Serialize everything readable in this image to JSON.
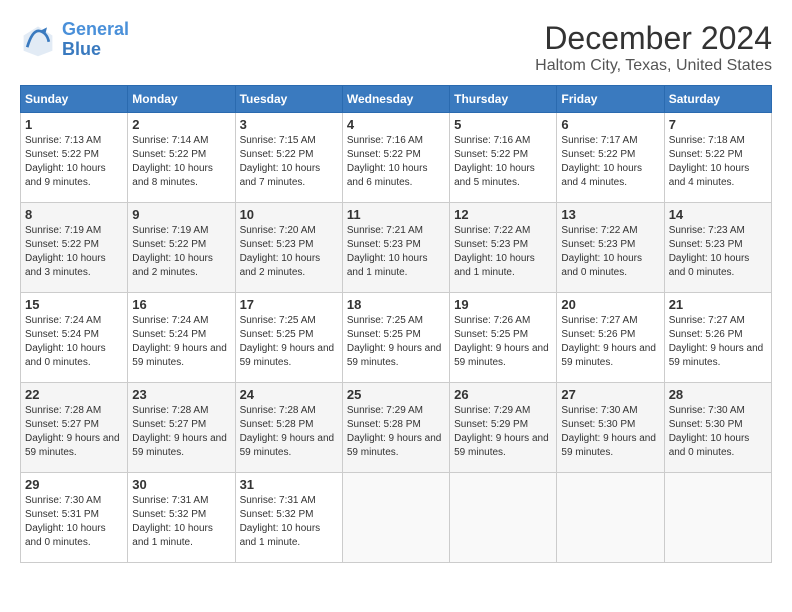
{
  "logo": {
    "line1": "General",
    "line2": "Blue"
  },
  "title": {
    "month_year": "December 2024",
    "location": "Haltom City, Texas, United States"
  },
  "weekdays": [
    "Sunday",
    "Monday",
    "Tuesday",
    "Wednesday",
    "Thursday",
    "Friday",
    "Saturday"
  ],
  "weeks": [
    [
      {
        "day": "1",
        "sunrise": "7:13 AM",
        "sunset": "5:22 PM",
        "daylight": "10 hours and 9 minutes."
      },
      {
        "day": "2",
        "sunrise": "7:14 AM",
        "sunset": "5:22 PM",
        "daylight": "10 hours and 8 minutes."
      },
      {
        "day": "3",
        "sunrise": "7:15 AM",
        "sunset": "5:22 PM",
        "daylight": "10 hours and 7 minutes."
      },
      {
        "day": "4",
        "sunrise": "7:16 AM",
        "sunset": "5:22 PM",
        "daylight": "10 hours and 6 minutes."
      },
      {
        "day": "5",
        "sunrise": "7:16 AM",
        "sunset": "5:22 PM",
        "daylight": "10 hours and 5 minutes."
      },
      {
        "day": "6",
        "sunrise": "7:17 AM",
        "sunset": "5:22 PM",
        "daylight": "10 hours and 4 minutes."
      },
      {
        "day": "7",
        "sunrise": "7:18 AM",
        "sunset": "5:22 PM",
        "daylight": "10 hours and 4 minutes."
      }
    ],
    [
      {
        "day": "8",
        "sunrise": "7:19 AM",
        "sunset": "5:22 PM",
        "daylight": "10 hours and 3 minutes."
      },
      {
        "day": "9",
        "sunrise": "7:19 AM",
        "sunset": "5:22 PM",
        "daylight": "10 hours and 2 minutes."
      },
      {
        "day": "10",
        "sunrise": "7:20 AM",
        "sunset": "5:23 PM",
        "daylight": "10 hours and 2 minutes."
      },
      {
        "day": "11",
        "sunrise": "7:21 AM",
        "sunset": "5:23 PM",
        "daylight": "10 hours and 1 minute."
      },
      {
        "day": "12",
        "sunrise": "7:22 AM",
        "sunset": "5:23 PM",
        "daylight": "10 hours and 1 minute."
      },
      {
        "day": "13",
        "sunrise": "7:22 AM",
        "sunset": "5:23 PM",
        "daylight": "10 hours and 0 minutes."
      },
      {
        "day": "14",
        "sunrise": "7:23 AM",
        "sunset": "5:23 PM",
        "daylight": "10 hours and 0 minutes."
      }
    ],
    [
      {
        "day": "15",
        "sunrise": "7:24 AM",
        "sunset": "5:24 PM",
        "daylight": "10 hours and 0 minutes."
      },
      {
        "day": "16",
        "sunrise": "7:24 AM",
        "sunset": "5:24 PM",
        "daylight": "9 hours and 59 minutes."
      },
      {
        "day": "17",
        "sunrise": "7:25 AM",
        "sunset": "5:25 PM",
        "daylight": "9 hours and 59 minutes."
      },
      {
        "day": "18",
        "sunrise": "7:25 AM",
        "sunset": "5:25 PM",
        "daylight": "9 hours and 59 minutes."
      },
      {
        "day": "19",
        "sunrise": "7:26 AM",
        "sunset": "5:25 PM",
        "daylight": "9 hours and 59 minutes."
      },
      {
        "day": "20",
        "sunrise": "7:27 AM",
        "sunset": "5:26 PM",
        "daylight": "9 hours and 59 minutes."
      },
      {
        "day": "21",
        "sunrise": "7:27 AM",
        "sunset": "5:26 PM",
        "daylight": "9 hours and 59 minutes."
      }
    ],
    [
      {
        "day": "22",
        "sunrise": "7:28 AM",
        "sunset": "5:27 PM",
        "daylight": "9 hours and 59 minutes."
      },
      {
        "day": "23",
        "sunrise": "7:28 AM",
        "sunset": "5:27 PM",
        "daylight": "9 hours and 59 minutes."
      },
      {
        "day": "24",
        "sunrise": "7:28 AM",
        "sunset": "5:28 PM",
        "daylight": "9 hours and 59 minutes."
      },
      {
        "day": "25",
        "sunrise": "7:29 AM",
        "sunset": "5:28 PM",
        "daylight": "9 hours and 59 minutes."
      },
      {
        "day": "26",
        "sunrise": "7:29 AM",
        "sunset": "5:29 PM",
        "daylight": "9 hours and 59 minutes."
      },
      {
        "day": "27",
        "sunrise": "7:30 AM",
        "sunset": "5:30 PM",
        "daylight": "9 hours and 59 minutes."
      },
      {
        "day": "28",
        "sunrise": "7:30 AM",
        "sunset": "5:30 PM",
        "daylight": "10 hours and 0 minutes."
      }
    ],
    [
      {
        "day": "29",
        "sunrise": "7:30 AM",
        "sunset": "5:31 PM",
        "daylight": "10 hours and 0 minutes."
      },
      {
        "day": "30",
        "sunrise": "7:31 AM",
        "sunset": "5:32 PM",
        "daylight": "10 hours and 1 minute."
      },
      {
        "day": "31",
        "sunrise": "7:31 AM",
        "sunset": "5:32 PM",
        "daylight": "10 hours and 1 minute."
      },
      null,
      null,
      null,
      null
    ]
  ]
}
